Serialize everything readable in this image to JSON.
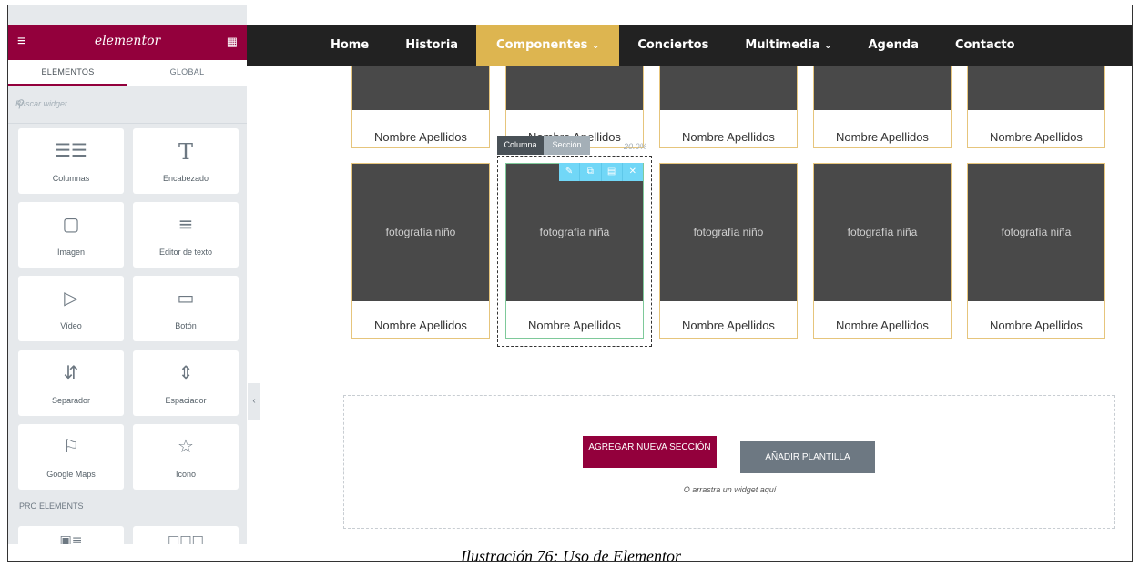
{
  "panel": {
    "logo": "elementor",
    "tabs": [
      "ELEMENTOS",
      "GLOBAL"
    ],
    "search_placeholder": "Buscar widget...",
    "widgets": [
      {
        "label": "Columnas",
        "icon": "columns-icon"
      },
      {
        "label": "Encabezado",
        "icon": "heading-icon"
      },
      {
        "label": "Imagen",
        "icon": "image-icon"
      },
      {
        "label": "Editor de texto",
        "icon": "text-editor-icon"
      },
      {
        "label": "Vídeo",
        "icon": "video-icon"
      },
      {
        "label": "Botón",
        "icon": "button-icon"
      },
      {
        "label": "Separador",
        "icon": "divider-icon"
      },
      {
        "label": "Espaciador",
        "icon": "spacer-icon"
      },
      {
        "label": "Google Maps",
        "icon": "map-icon"
      },
      {
        "label": "Icono",
        "icon": "star-icon"
      }
    ],
    "pro_title": "PRO ELEMENTS"
  },
  "nav": {
    "items": [
      "Home",
      "Historia",
      "Componentes",
      "Conciertos",
      "Multimedia",
      "Agenda",
      "Contacto"
    ],
    "accent_color": "#ddb550"
  },
  "cards": {
    "top_names": [
      "Nombre Apellidos",
      "Nombre Apellidos",
      "Nombre Apellidos",
      "Nombre Apellidos",
      "Nombre Apellidos"
    ],
    "photos": [
      "fotografía niño",
      "fotografía niña",
      "fotografía niño",
      "fotografía niña",
      "fotografía niña"
    ],
    "bottom_names": [
      "Nombre Apellidos",
      "Nombre Apellidos",
      "Nombre Apellidos",
      "Nombre Apellidos",
      "Nombre Apellidos"
    ]
  },
  "editor": {
    "column_tag": "Columna",
    "section_tag": "Sección",
    "width_pct": "20.0%"
  },
  "add_section": {
    "add_button": "AGREGAR NUEVA SECCIÓN",
    "template_button": "AÑADIR PLANTILLA",
    "drag_hint": "O arrastra un widget aquí"
  },
  "caption": "Ilustración 76: Uso de Elementor"
}
